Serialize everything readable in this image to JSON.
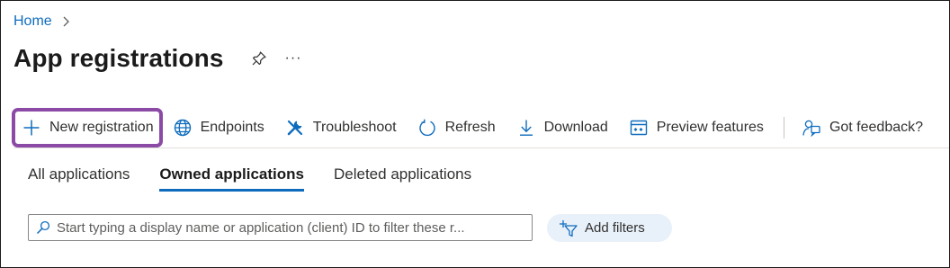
{
  "breadcrumb": {
    "home": "Home"
  },
  "page": {
    "title": "App registrations",
    "more": "···"
  },
  "toolbar": {
    "new_registration": "New registration",
    "endpoints": "Endpoints",
    "troubleshoot": "Troubleshoot",
    "refresh": "Refresh",
    "download": "Download",
    "preview_features": "Preview features",
    "got_feedback": "Got feedback?"
  },
  "tabs": [
    {
      "label": "All applications",
      "active": false
    },
    {
      "label": "Owned applications",
      "active": true
    },
    {
      "label": "Deleted applications",
      "active": false
    }
  ],
  "search": {
    "placeholder": "Start typing a display name or application (client) ID to filter these r..."
  },
  "filters": {
    "add_label": "Add filters"
  },
  "colors": {
    "accent": "#0f6cbd",
    "highlight_border": "#8b4aa5",
    "pill_bg": "#e8f1fa"
  },
  "icons": [
    "chevron-right-icon",
    "pin-icon",
    "plus-icon",
    "globe-icon",
    "wrench-icon",
    "refresh-icon",
    "download-icon",
    "preview-icon",
    "feedback-icon",
    "search-icon",
    "filter-add-icon"
  ]
}
